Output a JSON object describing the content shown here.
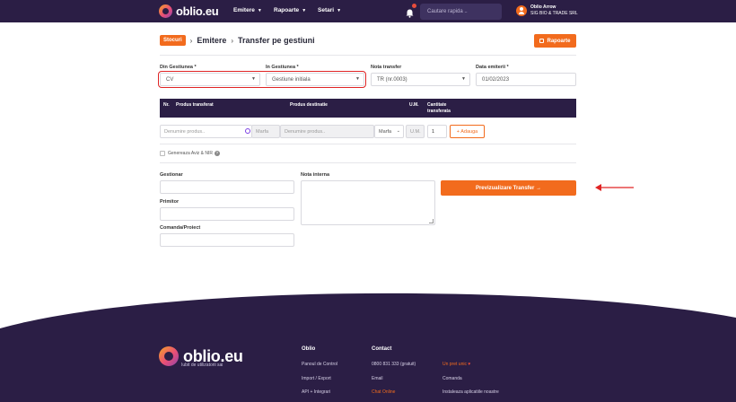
{
  "app": {
    "logo_text": "oblio.eu",
    "nav": [
      {
        "label": "Emitere"
      },
      {
        "label": "Rapoarte"
      },
      {
        "label": "Setari"
      }
    ],
    "search_placeholder": "Cautare rapida ..",
    "user": {
      "name": "Oblio Arrow",
      "company": "SIG BIO & TRADE SRL"
    }
  },
  "header": {
    "section_tag": "Stocuri",
    "breadcrumb_1": "Emitere",
    "breadcrumb_2": "Transfer pe gestiuni",
    "reports_button": "Rapoarte"
  },
  "form": {
    "from_label": "Din Gestiunea *",
    "from_value": "CV",
    "to_label": "In Gestiunea *",
    "to_value": "Gestiune initiala",
    "note_label": "Nota transfer",
    "note_value": "TR (nr.0003)",
    "date_label": "Data emiterii *",
    "date_value": "01/02/2023"
  },
  "table": {
    "headers": {
      "nr": "Nr.",
      "product_transferred": "Produs transferat",
      "product_destination": "Produs destinatie",
      "um": "U.M.",
      "qty_line1": "Cantitate",
      "qty_line2": "transferata"
    },
    "row": {
      "product_placeholder": "Denumire produs..",
      "type": "Marfa",
      "dest_placeholder": "Denumire produs..",
      "dest_type": "Marfa",
      "um_placeholder": "U.M.",
      "qty": "1",
      "add_button": "+ Adauga"
    }
  },
  "options": {
    "generate_label": "Genereaza Aviz & NIR"
  },
  "lower": {
    "gestionar_label": "Gestionar",
    "primitor_label": "Primitor",
    "comanda_label": "Comanda/Proiect",
    "nota_interna_label": "Nota interna",
    "preview_button": "Previzualizare Transfer →"
  },
  "footer": {
    "tagline": "Iubit de utilizatorii sai",
    "col1_title": "Oblio",
    "col1_links": [
      "Panoul de Control",
      "Import / Export",
      "API + Integrari"
    ],
    "col2_title": "Contact",
    "col2_links": [
      "0800 831 333 (gratuit)",
      "Email",
      "Chat Online"
    ],
    "col3_links": [
      "Un pret unic",
      "Comanda",
      "Instaleaza aplicatiile noastre"
    ]
  },
  "colors": {
    "nav_bg": "#2b1e45",
    "accent": "#f26b1d",
    "highlight": "#e02424"
  },
  "icons": [
    "bell-icon",
    "user-icon",
    "report-icon",
    "help-icon",
    "heart-icon",
    "arrow-icon"
  ]
}
